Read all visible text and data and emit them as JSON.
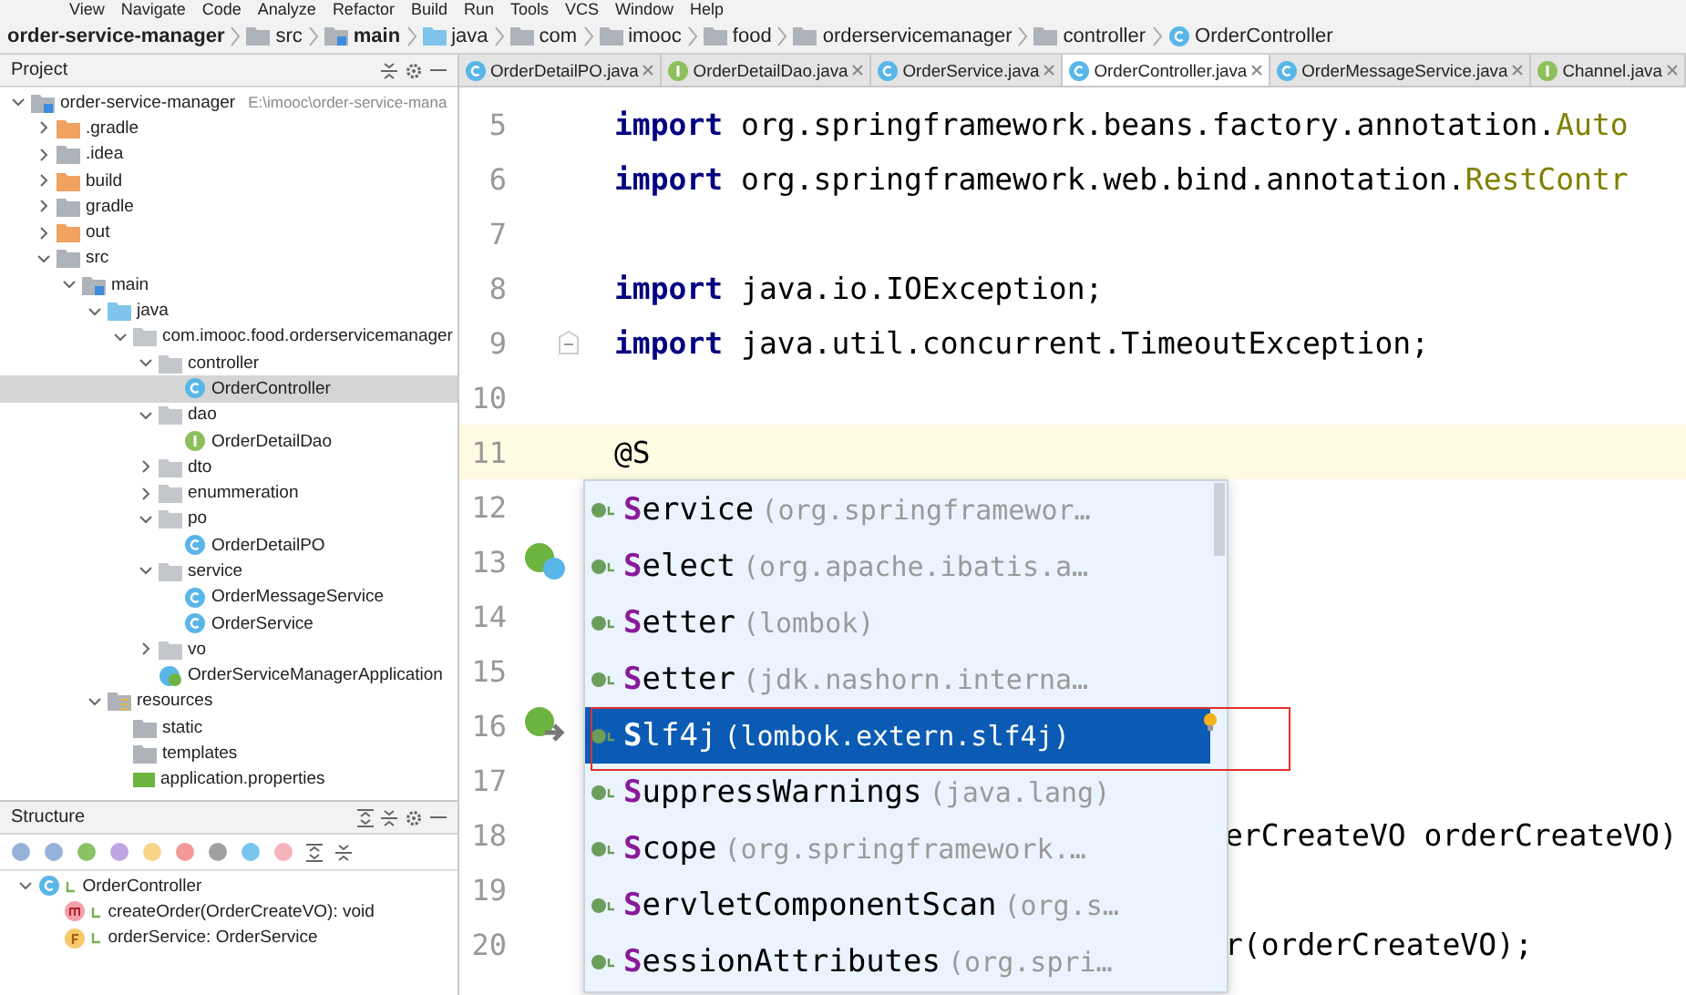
{
  "menu": [
    "View",
    "Navigate",
    "Code",
    "Analyze",
    "Refactor",
    "Build",
    "Run",
    "Tools",
    "VCS",
    "Window",
    "Help"
  ],
  "breadcrumb": [
    {
      "label": "order-service-manager",
      "kind": "module"
    },
    {
      "label": "src",
      "kind": "folder"
    },
    {
      "label": "main",
      "kind": "module"
    },
    {
      "label": "java",
      "kind": "source"
    },
    {
      "label": "com",
      "kind": "folder"
    },
    {
      "label": "imooc",
      "kind": "folder"
    },
    {
      "label": "food",
      "kind": "folder"
    },
    {
      "label": "orderservicemanager",
      "kind": "folder"
    },
    {
      "label": "controller",
      "kind": "folder"
    },
    {
      "label": "OrderController",
      "kind": "class"
    }
  ],
  "project_panel": {
    "title": "Project",
    "tree": [
      {
        "label": "order-service-manager",
        "path": "E:\\imooc\\order-service-mana",
        "kind": "module",
        "expanded": true,
        "selected": false,
        "children": [
          {
            "label": ".gradle",
            "kind": "excluded",
            "expanded": false,
            "selected": false
          },
          {
            "label": ".idea",
            "kind": "folder",
            "expanded": false,
            "selected": false
          },
          {
            "label": "build",
            "kind": "excluded",
            "expanded": false,
            "selected": false
          },
          {
            "label": "gradle",
            "kind": "folder",
            "expanded": false,
            "selected": false
          },
          {
            "label": "out",
            "kind": "excluded",
            "expanded": false,
            "selected": false
          },
          {
            "label": "src",
            "kind": "folder",
            "expanded": true,
            "selected": false,
            "children": [
              {
                "label": "main",
                "kind": "module",
                "expanded": true,
                "selected": false,
                "children": [
                  {
                    "label": "java",
                    "kind": "source",
                    "expanded": true,
                    "selected": false,
                    "children": [
                      {
                        "label": "com.imooc.food.orderservicemanager",
                        "kind": "package",
                        "expanded": true,
                        "selected": false,
                        "children": [
                          {
                            "label": "controller",
                            "kind": "package",
                            "expanded": true,
                            "selected": false,
                            "children": [
                              {
                                "label": "OrderController",
                                "kind": "class",
                                "selected": true
                              }
                            ]
                          },
                          {
                            "label": "dao",
                            "kind": "package",
                            "expanded": true,
                            "selected": false,
                            "children": [
                              {
                                "label": "OrderDetailDao",
                                "kind": "interface",
                                "selected": false
                              }
                            ]
                          },
                          {
                            "label": "dto",
                            "kind": "package",
                            "expanded": false,
                            "selected": false
                          },
                          {
                            "label": "enummeration",
                            "kind": "package",
                            "expanded": false,
                            "selected": false
                          },
                          {
                            "label": "po",
                            "kind": "package",
                            "expanded": true,
                            "selected": false,
                            "children": [
                              {
                                "label": "OrderDetailPO",
                                "kind": "class",
                                "selected": false
                              }
                            ]
                          },
                          {
                            "label": "service",
                            "kind": "package",
                            "expanded": true,
                            "selected": false,
                            "children": [
                              {
                                "label": "OrderMessageService",
                                "kind": "class",
                                "selected": false
                              },
                              {
                                "label": "OrderService",
                                "kind": "class",
                                "selected": false
                              }
                            ]
                          },
                          {
                            "label": "vo",
                            "kind": "package",
                            "expanded": false,
                            "selected": false
                          },
                          {
                            "label": "OrderServiceManagerApplication",
                            "kind": "app",
                            "selected": false
                          }
                        ]
                      }
                    ]
                  },
                  {
                    "label": "resources",
                    "kind": "resources",
                    "expanded": true,
                    "selected": false,
                    "children": [
                      {
                        "label": "static",
                        "kind": "folder",
                        "selected": false
                      },
                      {
                        "label": "templates",
                        "kind": "folder",
                        "selected": false
                      },
                      {
                        "label": "application.properties",
                        "kind": "properties",
                        "selected": false
                      }
                    ]
                  }
                ]
              }
            ]
          }
        ]
      }
    ]
  },
  "structure_panel": {
    "title": "Structure",
    "tree": [
      {
        "label": "OrderController",
        "kind": "class",
        "expanded": true,
        "children": [
          {
            "label": "createOrder(OrderCreateVO): void",
            "kind": "method"
          },
          {
            "label": "orderService: OrderService",
            "kind": "field"
          }
        ]
      }
    ]
  },
  "tabs": [
    {
      "label": "OrderDetailPO.java",
      "kind": "class",
      "selected": false
    },
    {
      "label": "OrderDetailDao.java",
      "kind": "interface",
      "selected": false
    },
    {
      "label": "OrderService.java",
      "kind": "class",
      "selected": false
    },
    {
      "label": "OrderController.java",
      "kind": "class",
      "selected": true
    },
    {
      "label": "OrderMessageService.java",
      "kind": "class",
      "selected": false
    },
    {
      "label": "Channel.java",
      "kind": "interface",
      "selected": false
    }
  ],
  "code_lines": [
    {
      "number": "5",
      "kind": "code",
      "segments": [
        {
          "text": "import",
          "kind": "keyword"
        },
        {
          "text": " org.springframework.beans.factory.annotation.",
          "kind": "plain"
        },
        {
          "text": "Auto",
          "kind": "type"
        }
      ]
    },
    {
      "number": "6",
      "kind": "code",
      "segments": [
        {
          "text": "import",
          "kind": "keyword"
        },
        {
          "text": " org.springframework.web.bind.annotation.",
          "kind": "plain"
        },
        {
          "text": "RestContr",
          "kind": "type"
        }
      ]
    },
    {
      "number": "7",
      "kind": "code"
    },
    {
      "number": "8",
      "kind": "code",
      "segments": [
        {
          "text": "import",
          "kind": "keyword"
        },
        {
          "text": " java.io.IOException;",
          "kind": "plain"
        }
      ]
    },
    {
      "number": "9",
      "kind": "code",
      "fold": true,
      "segments": [
        {
          "text": "import",
          "kind": "keyword"
        },
        {
          "text": " java.util.concurrent.TimeoutException;",
          "kind": "plain"
        }
      ]
    },
    {
      "number": "10",
      "kind": "code"
    },
    {
      "number": "11",
      "kind": "code",
      "current": true,
      "segments": [
        {
          "text": "@S",
          "kind": "plain"
        }
      ]
    },
    {
      "number": "12",
      "kind": "code"
    },
    {
      "number": "13",
      "kind": "bean"
    },
    {
      "number": "14",
      "kind": "code"
    },
    {
      "number": "15",
      "kind": "code"
    },
    {
      "number": "16",
      "kind": "run"
    },
    {
      "number": "17",
      "kind": "code"
    },
    {
      "number": "18",
      "kind": "code",
      "partial": true,
      "segments": [
        {
          "text": "erCreateVO orderCreateVO)",
          "kind": "plain"
        }
      ]
    },
    {
      "number": "19",
      "kind": "code"
    },
    {
      "number": "20",
      "kind": "code",
      "partial": true,
      "segments": [
        {
          "text": "r(orderCreateVO);",
          "kind": "plain"
        }
      ]
    }
  ],
  "completion": [
    {
      "name": "Service",
      "detail": "(org.springframewor…",
      "selected": false
    },
    {
      "name": "Select",
      "detail": "(org.apache.ibatis.a…",
      "selected": false
    },
    {
      "name": "Setter",
      "detail": "(lombok)",
      "selected": false
    },
    {
      "name": "Setter",
      "detail": "(jdk.nashorn.interna…",
      "selected": false
    },
    {
      "name": "Slf4j",
      "detail": "(lombok.extern.slf4j)",
      "selected": true
    },
    {
      "name": "SuppressWarnings",
      "detail": "(java.lang)",
      "selected": false
    },
    {
      "name": "Scope",
      "detail": "(org.springframework.…",
      "selected": false
    },
    {
      "name": "ServletComponentScan",
      "detail": "(org.s…",
      "selected": false
    },
    {
      "name": "SessionAttributes",
      "detail": "(org.spri…",
      "selected": false
    }
  ]
}
